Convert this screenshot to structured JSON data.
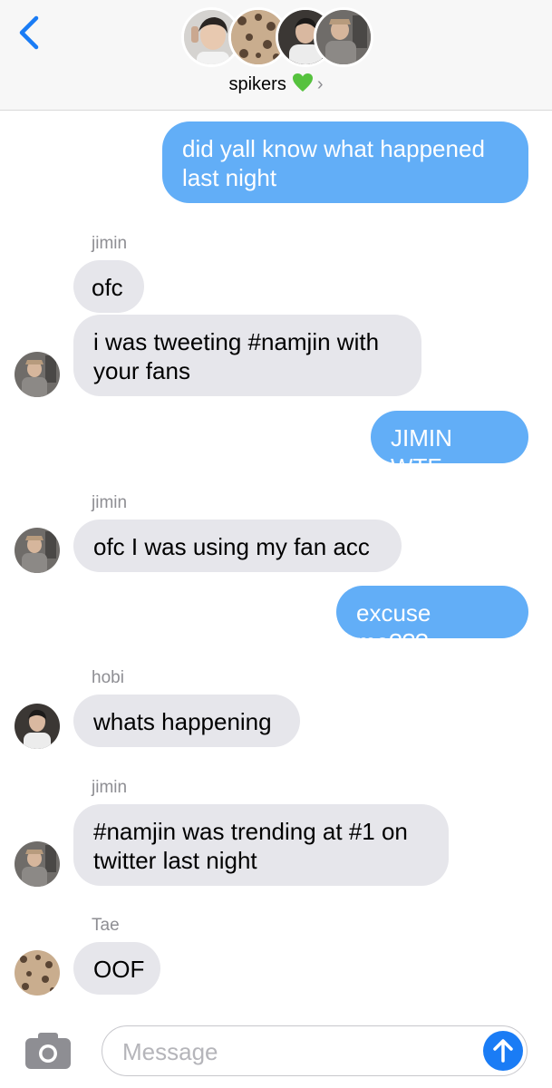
{
  "header": {
    "back_icon": "chevron-left-icon",
    "group_name": "spikers",
    "group_emoji": "💚",
    "chevron": "›"
  },
  "messages": [
    {
      "type": "sent",
      "text": "did yall know what happened last night"
    },
    {
      "type": "sender",
      "name": "jimin"
    },
    {
      "type": "recv",
      "text": "ofc"
    },
    {
      "type": "recv",
      "text": "i was tweeting #namjin with your fans"
    },
    {
      "type": "sent",
      "text": "JIMIN WTF"
    },
    {
      "type": "sender",
      "name": "jimin"
    },
    {
      "type": "recv",
      "text": "ofc I was using my fan acc"
    },
    {
      "type": "sent",
      "text": "excuse me???"
    },
    {
      "type": "sender",
      "name": "hobi"
    },
    {
      "type": "recv",
      "text": "whats happening"
    },
    {
      "type": "sender",
      "name": "jimin"
    },
    {
      "type": "recv",
      "text": "#namjin was trending at #1 on twitter last night"
    },
    {
      "type": "sender",
      "name": "Tae"
    },
    {
      "type": "recv",
      "text": "OOF"
    }
  ],
  "composer": {
    "placeholder": "Message",
    "camera_icon": "camera-icon",
    "send_icon": "arrow-up-icon"
  },
  "colors": {
    "sent_bubble": "#62aef7",
    "received_bubble": "#e6e6eb",
    "accent": "#1a7cf5"
  }
}
